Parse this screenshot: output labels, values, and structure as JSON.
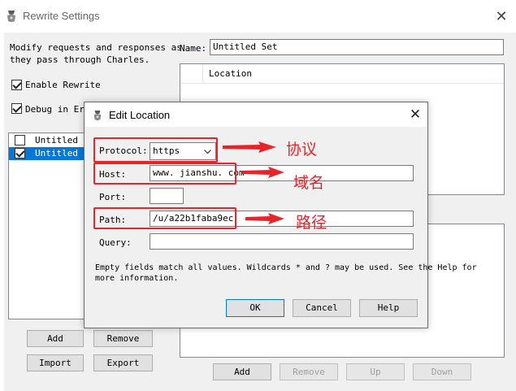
{
  "window": {
    "title": "Rewrite Settings",
    "close_glyph": "✕"
  },
  "left": {
    "description_line1": "Modify requests and responses as",
    "description_line2": "they pass through Charles.",
    "enable_rewrite_label": "Enable Rewrite",
    "debug_label": "Debug in Err",
    "sets": [
      {
        "label": "Untitled S",
        "checked": false,
        "selected": false
      },
      {
        "label": "Untitled S",
        "checked": true,
        "selected": true
      }
    ],
    "buttons": {
      "add": "Add",
      "remove": "Remove",
      "import": "Import",
      "export": "Export"
    }
  },
  "right": {
    "name_label": "Name:",
    "name_value": "Untitled Set",
    "location_header": "Location",
    "buttons": {
      "add": "Add",
      "remove": "Remove",
      "up": "Up",
      "down": "Down"
    }
  },
  "dialog": {
    "title": "Edit Location",
    "close_glyph": "✕",
    "protocol_label": "Protocol:",
    "protocol_value": "https",
    "host_label": "Host:",
    "host_value": "www. jianshu. com",
    "port_label": "Port:",
    "port_value": "",
    "path_label": "Path:",
    "path_value": "/u/a22b1faba9ec",
    "query_label": "Query:",
    "query_value": "",
    "help_line1": "Empty fields match all values. Wildcards * and ? may be used. See the Help for",
    "help_line2": "more information.",
    "buttons": {
      "ok": "OK",
      "cancel": "Cancel",
      "help": "Help"
    }
  },
  "annotations": {
    "protocol": "协议",
    "host": "域名",
    "path": "路径",
    "color": "#e8242a"
  },
  "colors": {
    "selection": "#0078d7",
    "dialog_bg": "#f0f0f0"
  }
}
